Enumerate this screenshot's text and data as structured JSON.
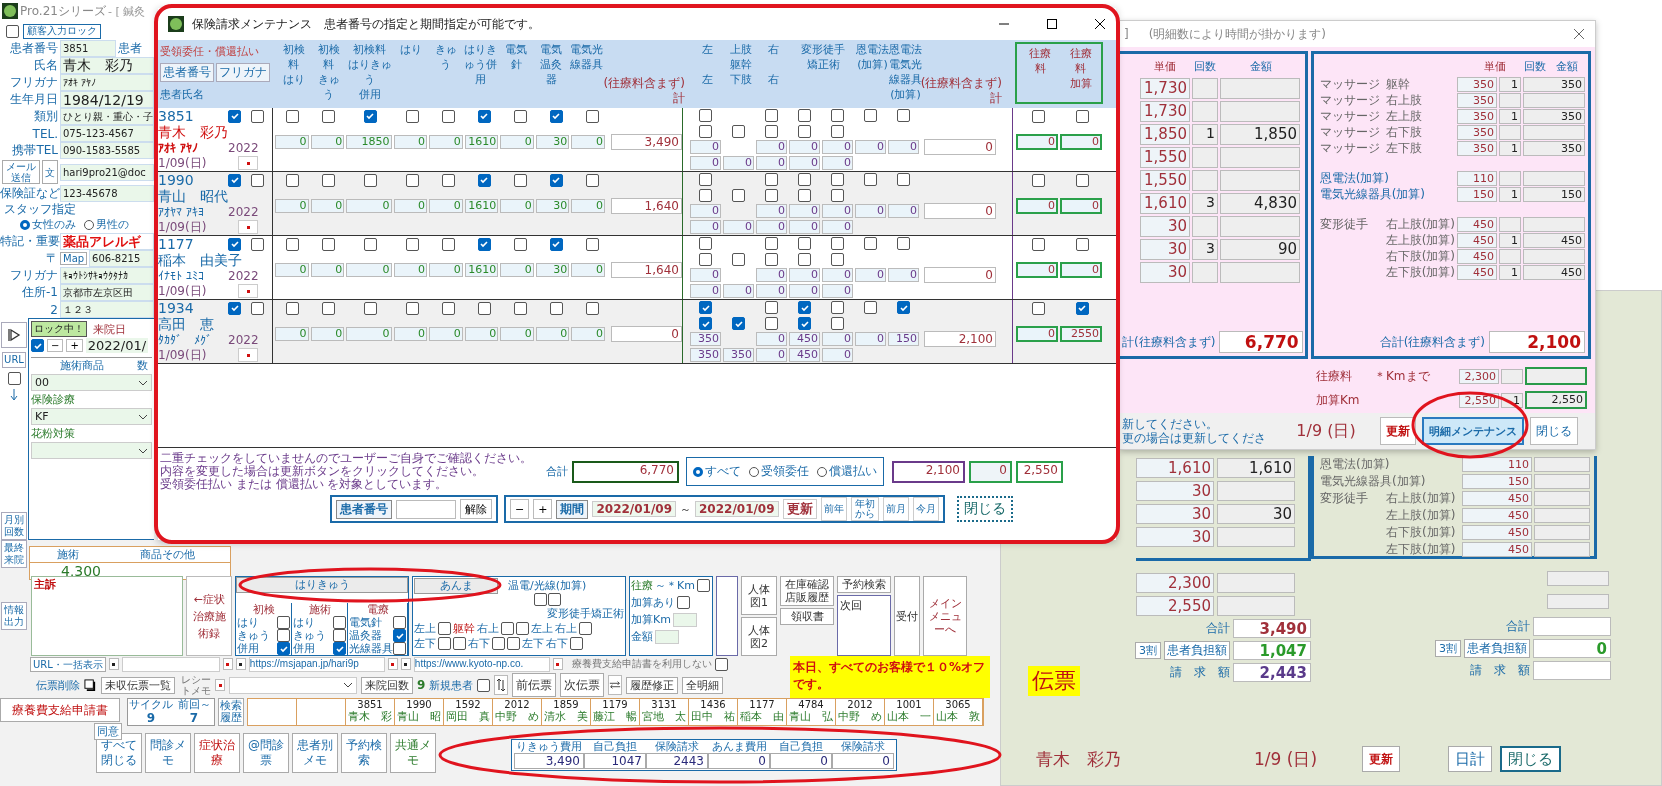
{
  "app": {
    "title": "Pro.21シリーズ",
    "title_suffix": "- [ 鍼灸",
    "lock_button": "顧客入力ロック",
    "lock_checked": false,
    "patient": [
      {
        "kind": "field",
        "label": "患者番号",
        "value": "3851",
        "extra": "患者"
      },
      {
        "kind": "large",
        "label": "氏名",
        "value": "青木　彩乃"
      },
      {
        "kind": "field",
        "label": "フリガナ",
        "value": "ｱｵｷ ｱﾔﾉ"
      },
      {
        "kind": "large",
        "label": "生年月日",
        "value": "1984/12/19"
      },
      {
        "kind": "field",
        "label": "類別",
        "value": "ひとり親・重心・子"
      },
      {
        "kind": "field",
        "label": "TEL.",
        "value": "075-123-4567"
      },
      {
        "kind": "field",
        "label": "携帯TEL",
        "value": "090-1583-5585"
      },
      {
        "kind": "mail",
        "buttons": [
          "メール送信",
          "文"
        ],
        "value": "hari9pro21@doc"
      },
      {
        "kind": "field",
        "label": "保険証など",
        "value": "123-45678"
      },
      {
        "kind": "radio",
        "label": "スタッフ指定",
        "options": [
          {
            "label": "女性のみ",
            "selected": true
          },
          {
            "label": "男性の",
            "selected": false
          }
        ]
      },
      {
        "kind": "alert",
        "label": "特記・重要",
        "value": "薬品アレルギ"
      },
      {
        "kind": "postal",
        "label": "〒",
        "button": "Map",
        "value": "606-8215"
      },
      {
        "kind": "field",
        "label": "フリガナ",
        "value": "ｷｮｳﾄｼｻｷｮｳｸﾀﾅｶ"
      },
      {
        "kind": "field",
        "label": "住所-1",
        "value": "京都市左京区田"
      },
      {
        "kind": "field",
        "label": "2",
        "value": "１２３"
      }
    ],
    "url_button": "URL",
    "strip_checked": false,
    "month_buttons": [
      "月別回数",
      "最終来院"
    ],
    "info_button": "情報出力",
    "visit": {
      "lock": "ロック中！",
      "label": "来院日",
      "checked": true,
      "minus": "−",
      "plus": "+",
      "date": "2022/01/",
      "product_label": "施術商品",
      "qty_label": "数",
      "products": [
        {
          "value": "00"
        },
        {
          "title": "保険診療",
          "value": "KF"
        },
        {
          "title": "花粉対策"
        }
      ]
    },
    "sales": {
      "columns": [
        "施術",
        "商品その他"
      ],
      "value": "4,300"
    },
    "complaint": "主訴",
    "symptom_button": "←症状治療施術録",
    "hk": {
      "button": "はりきゅう",
      "groups": [
        {
          "title": "初検",
          "items": [
            {
              "label": "はり",
              "checked": false
            },
            {
              "label": "きゅう",
              "checked": false
            },
            {
              "label": "併用",
              "checked": true
            }
          ]
        },
        {
          "title": "施術",
          "items": [
            {
              "label": "はり",
              "checked": false
            },
            {
              "label": "きゅう",
              "checked": false
            },
            {
              "label": "併用",
              "checked": true
            }
          ]
        },
        {
          "title": "電療",
          "items": [
            {
              "label": "電気針",
              "checked": false
            },
            {
              "label": "温灸器",
              "checked": true
            },
            {
              "label": "光線器具",
              "checked": false
            }
          ]
        }
      ]
    },
    "anma": {
      "button": "あんま",
      "onden_label": "温電/光線(加算)",
      "onden": [
        {
          "checked": false
        },
        {
          "checked": false
        }
      ],
      "deform_label": "変形徒手矯正術",
      "lines": [
        [
          {
            "kind": "label",
            "text": "左上"
          },
          {
            "kind": "check",
            "checked": false
          },
          {
            "kind": "label",
            "text": "躯幹",
            "accent": true
          },
          {
            "kind": "label",
            "text": "右上"
          },
          {
            "kind": "check",
            "checked": false
          },
          {
            "kind": "check",
            "checked": false
          },
          {
            "kind": "label",
            "text": "左上"
          },
          {
            "kind": "label",
            "text": "右上"
          },
          {
            "kind": "check",
            "checked": false
          }
        ],
        [
          {
            "kind": "label",
            "text": "左下"
          },
          {
            "kind": "check",
            "checked": false
          },
          {
            "kind": "check",
            "checked": false
          },
          {
            "kind": "label",
            "text": "右下"
          },
          {
            "kind": "check",
            "checked": false
          },
          {
            "kind": "check",
            "checked": false
          },
          {
            "kind": "label",
            "text": "左下"
          },
          {
            "kind": "label",
            "text": "右下"
          },
          {
            "kind": "check",
            "checked": false
          }
        ]
      ]
    },
    "ouryo": {
      "title": "往療",
      "range": "～＊Km",
      "checked": false,
      "add_label": "加算あり",
      "add_checked": false,
      "km_label": "加算Km",
      "amount_label": "金額"
    },
    "body_buttons": [
      "人体図1",
      "人体図2"
    ],
    "tools": {
      "stock": "在庫確認店販履歴",
      "receipt": "領収書",
      "reserve": "予約検索",
      "next": "次回",
      "accept": "受付",
      "menu": "メインメニューへ"
    },
    "notice": "本日、すべてのお客様で１０%オフです。",
    "url_row": {
      "button": "URL・一括表示",
      "urls": [
        "https://msjapan.jp/hari9p",
        "https://www.kyoto-np.co."
      ]
    },
    "opt_out": {
      "label": "療養費支給申請書を利用しない",
      "checked": false
    },
    "slip_row": {
      "delete": "伝票削除",
      "unpaid": "未収伝票一覧",
      "receipt_label": "レシートメモ",
      "visits_label": "来院回数",
      "visits": "9",
      "new_label": "新規患者",
      "new_checked": false,
      "prev": "前伝票",
      "next": "次伝票",
      "history": "履歴修正",
      "all": "全明細"
    },
    "claim_row": {
      "button": "療養費支給申請書",
      "agree": "同意",
      "cycle_label": "サイクル",
      "cycle": "9",
      "prev_label": "前回～",
      "prev": "7",
      "search": "検索履歴",
      "recent": [
        {
          "id": "3851",
          "name": "青木　彩"
        },
        {
          "id": "1990",
          "name": "青山　昭"
        },
        {
          "id": "1592",
          "name": "岡田　真"
        },
        {
          "id": "2012",
          "name": "中野　め"
        },
        {
          "id": "1859",
          "name": "清水　美"
        },
        {
          "id": "1179",
          "name": "藤江　暢"
        },
        {
          "id": "3131",
          "name": "宮地　太"
        },
        {
          "id": "1436",
          "name": "田中　祐"
        },
        {
          "id": "1177",
          "name": "稲本　由"
        },
        {
          "id": "4784",
          "name": "青山　弘"
        },
        {
          "id": "2012",
          "name": "中野　め"
        },
        {
          "id": "1001",
          "name": "山本　一"
        },
        {
          "id": "3065",
          "name": "山本　敦"
        }
      ]
    },
    "bottom_buttons": [
      "すべて閉じる",
      "問診メモ",
      "症状治療",
      "@問診票",
      "患者別メモ",
      "予約検索",
      "共通メモ"
    ],
    "summary": {
      "columns": [
        "りきゅう費用",
        "自己負担",
        "保険請求",
        "あんま費用",
        "自己負担",
        "保険請求"
      ],
      "values": [
        "3,490",
        "1047",
        "2443",
        "0",
        "0",
        "0"
      ]
    }
  },
  "dialog": {
    "title": "保険請求メンテナンス　患者番号の指定と期間指定が可能です。",
    "header": {
      "payment": "受領委任・償還払い",
      "sort_buttons": [
        "患者番号",
        "フリガナ"
      ],
      "name_label": "患者氏名",
      "left_columns": [
        [
          "初検",
          "料",
          "はり"
        ],
        [
          "初検",
          "料",
          "きゅ",
          "う"
        ],
        [
          "初検料",
          "はりきゅ",
          "う",
          "併用"
        ],
        [
          "はり"
        ],
        [
          "きゅ",
          "う"
        ],
        [
          "はりき",
          "ゅう併",
          "用"
        ],
        [
          "電気",
          "針"
        ],
        [
          "電気",
          "温灸",
          "器"
        ],
        [
          "電気光",
          "線器具"
        ]
      ],
      "left_total": [
        "(往療料含まず)",
        "計"
      ],
      "right_columns": [
        [
          "左",
          "左"
        ],
        [
          "上肢",
          "躯幹",
          "下肢"
        ],
        [
          "右",
          "右"
        ],
        [
          "変形徒手",
          "矯正術"
        ],
        [
          "恩電法",
          "(加算)"
        ],
        [
          "恩電法",
          "電気光",
          "線器具",
          "(加算)"
        ]
      ],
      "right_total": [
        "(往療料含まず)",
        "計"
      ],
      "outbound_columns": [
        [
          "往療",
          "料"
        ],
        [
          "往療",
          "料",
          "加算"
        ]
      ]
    },
    "rows": [
      {
        "id": "3851",
        "name": "青木　彩乃",
        "kana": "ｱｵｷ ｱﾔﾉ",
        "current": true,
        "year": "2022",
        "date": "1/09(日)",
        "select": true,
        "flag": false,
        "items": [
          {
            "checked": false,
            "value": "0"
          },
          {
            "checked": false,
            "value": "0"
          },
          {
            "checked": true,
            "value": "1850"
          },
          {
            "checked": false,
            "value": "0"
          },
          {
            "checked": false,
            "value": "0"
          },
          {
            "checked": true,
            "value": "1610"
          },
          {
            "checked": false,
            "value": "0"
          },
          {
            "checked": true,
            "value": "30"
          },
          {
            "checked": false,
            "value": "0"
          }
        ],
        "total": "3,490",
        "massage_top": [
          {
            "checked": false,
            "value": "0"
          },
          {
            "checked": false,
            "value": "0"
          },
          {
            "checked": false,
            "value": "0"
          },
          {
            "checked": false,
            "value": "0"
          },
          {
            "checked": false,
            "value": "0"
          },
          {
            "checked": false,
            "value": "0"
          }
        ],
        "massage_bottom": [
          {
            "checked": false,
            "value": "0"
          },
          {
            "checked": false,
            "value": "0"
          },
          {
            "checked": false,
            "value": "0"
          },
          {
            "checked": false,
            "value": "0"
          },
          {
            "checked": false,
            "value": "0"
          }
        ],
        "massage_total": "0",
        "outbound": [
          {
            "checked": false,
            "value": "0"
          },
          {
            "checked": false,
            "value": "0"
          }
        ]
      },
      {
        "id": "1990",
        "name": "青山　昭代",
        "kana": "ｱｵﾔﾏ ｱｷﾖ",
        "current": false,
        "year": "2022",
        "date": "1/09(日)",
        "select": true,
        "flag": false,
        "items": [
          {
            "checked": false,
            "value": "0"
          },
          {
            "checked": false,
            "value": "0"
          },
          {
            "checked": false,
            "value": "0"
          },
          {
            "checked": false,
            "value": "0"
          },
          {
            "checked": false,
            "value": "0"
          },
          {
            "checked": true,
            "value": "1610"
          },
          {
            "checked": false,
            "value": "0"
          },
          {
            "checked": true,
            "value": "30"
          },
          {
            "checked": false,
            "value": "0"
          }
        ],
        "total": "1,640",
        "massage_top": [
          {
            "checked": false,
            "value": "0"
          },
          {
            "checked": false,
            "value": "0"
          },
          {
            "checked": false,
            "value": "0"
          },
          {
            "checked": false,
            "value": "0"
          },
          {
            "checked": false,
            "value": "0"
          },
          {
            "checked": false,
            "value": "0"
          }
        ],
        "massage_bottom": [
          {
            "checked": false,
            "value": "0"
          },
          {
            "checked": false,
            "value": "0"
          },
          {
            "checked": false,
            "value": "0"
          },
          {
            "checked": false,
            "value": "0"
          },
          {
            "checked": false,
            "value": "0"
          }
        ],
        "massage_total": "0",
        "outbound": [
          {
            "checked": false,
            "value": "0"
          },
          {
            "checked": false,
            "value": "0"
          }
        ]
      },
      {
        "id": "1177",
        "name": "稲本　由美子",
        "kana": "ｲﾅﾓﾄ ﾕﾐｺ",
        "current": false,
        "year": "2022",
        "date": "1/09(日)",
        "select": true,
        "flag": false,
        "items": [
          {
            "checked": false,
            "value": "0"
          },
          {
            "checked": false,
            "value": "0"
          },
          {
            "checked": false,
            "value": "0"
          },
          {
            "checked": false,
            "value": "0"
          },
          {
            "checked": false,
            "value": "0"
          },
          {
            "checked": true,
            "value": "1610"
          },
          {
            "checked": false,
            "value": "0"
          },
          {
            "checked": true,
            "value": "30"
          },
          {
            "checked": false,
            "value": "0"
          }
        ],
        "total": "1,640",
        "massage_top": [
          {
            "checked": false,
            "value": "0"
          },
          {
            "checked": false,
            "value": "0"
          },
          {
            "checked": false,
            "value": "0"
          },
          {
            "checked": false,
            "value": "0"
          },
          {
            "checked": false,
            "value": "0"
          },
          {
            "checked": false,
            "value": "0"
          }
        ],
        "massage_bottom": [
          {
            "checked": false,
            "value": "0"
          },
          {
            "checked": false,
            "value": "0"
          },
          {
            "checked": false,
            "value": "0"
          },
          {
            "checked": false,
            "value": "0"
          },
          {
            "checked": false,
            "value": "0"
          }
        ],
        "massage_total": "0",
        "outbound": [
          {
            "checked": false,
            "value": "0"
          },
          {
            "checked": false,
            "value": "0"
          }
        ]
      },
      {
        "id": "1934",
        "name": "高田　恵",
        "kana": "ﾀｶﾀﾞ　ﾒｸﾞ",
        "current": false,
        "year": "2022",
        "date": "1/09(日)",
        "select": true,
        "flag": false,
        "items": [
          {
            "checked": false,
            "value": "0"
          },
          {
            "checked": false,
            "value": "0"
          },
          {
            "checked": false,
            "value": "0"
          },
          {
            "checked": false,
            "value": "0"
          },
          {
            "checked": false,
            "value": "0"
          },
          {
            "checked": false,
            "value": "0"
          },
          {
            "checked": false,
            "value": "0"
          },
          {
            "checked": false,
            "value": "0"
          },
          {
            "checked": false,
            "value": "0"
          }
        ],
        "total": "0",
        "massage_top": [
          {
            "checked": true,
            "value": "350"
          },
          {
            "checked": false,
            "value": "0"
          },
          {
            "checked": true,
            "value": "450"
          },
          {
            "checked": false,
            "value": "0"
          },
          {
            "checked": false,
            "value": "0"
          },
          {
            "checked": true,
            "value": "150"
          }
        ],
        "massage_bottom": [
          {
            "checked": true,
            "value": "350"
          },
          {
            "checked": true,
            "value": "350"
          },
          {
            "checked": false,
            "value": "0"
          },
          {
            "checked": true,
            "value": "450"
          },
          {
            "checked": false,
            "value": "0"
          }
        ],
        "massage_total": "2,100",
        "outbound": [
          {
            "checked": false,
            "value": "0"
          },
          {
            "checked": true,
            "value": "2550"
          }
        ]
      }
    ],
    "footer": {
      "notes": [
        "二重チェックをしていませんのでユーザーご自身でご確認ください。",
        "内容を変更した場合は更新ボタンをクリックしてください。",
        "受領委任払い または 償還払い を対象としています。"
      ],
      "total_label": "合計",
      "total": "6,770",
      "filters": [
        {
          "label": "すべて",
          "selected": true
        },
        {
          "label": "受領委任",
          "selected": false
        },
        {
          "label": "償還払い",
          "selected": false
        }
      ],
      "totals": [
        "2,100",
        "0",
        "2,550"
      ],
      "patient_label": "患者番号",
      "clear": "解除",
      "minus": "−",
      "plus": "+",
      "period_label": "期間",
      "from": "2022/01/09",
      "tilde": "～",
      "to": "2022/01/09",
      "refresh": "更新",
      "nav": [
        "前年",
        "年初から",
        "前月",
        "今月"
      ],
      "close": "閉じる"
    }
  },
  "detail": {
    "title_prefix": "]",
    "title": "(明細数により時間が掛かります)",
    "left": {
      "columns": [
        "単価",
        "回数",
        "金額"
      ],
      "rows": [
        {
          "price": "1,730"
        },
        {
          "price": "1,730"
        },
        {
          "price": "1,850",
          "count": "1",
          "amount": "1,850"
        },
        {
          "price": "1,550"
        },
        {
          "price": "1,550"
        },
        {
          "price": "1,610",
          "count": "3",
          "amount": "4,830"
        },
        {
          "price": "30"
        },
        {
          "price": "30",
          "count": "3",
          "amount": "90"
        },
        {
          "price": "30"
        }
      ],
      "total_label": "計(往療料含まず)",
      "total": "6,770"
    },
    "right": {
      "columns": [
        "単価",
        "回数",
        "金額"
      ],
      "groups": [
        [
          {
            "label": "マッサージ",
            "part": "躯幹",
            "price": "350",
            "count": "1",
            "amount": "350"
          },
          {
            "label": "マッサージ",
            "part": "右上肢",
            "price": "350"
          },
          {
            "label": "マッサージ",
            "part": "左上肢",
            "price": "350",
            "count": "1",
            "amount": "350"
          },
          {
            "label": "マッサージ",
            "part": "右下肢",
            "price": "350"
          },
          {
            "label": "マッサージ",
            "part": "左下肢",
            "price": "350",
            "count": "1",
            "amount": "350"
          }
        ],
        [
          {
            "label": "恩電法(加算)",
            "price": "110"
          },
          {
            "label": "電気光線器具(加算)",
            "price": "150",
            "count": "1",
            "amount": "150"
          }
        ],
        [
          {
            "label": "変形徒手",
            "part": "右上肢(加算)",
            "price": "450"
          },
          {
            "part": "左上肢(加算)",
            "price": "450",
            "count": "1",
            "amount": "450"
          },
          {
            "part": "右下肢(加算)",
            "price": "450"
          },
          {
            "part": "左下肢(加算)",
            "price": "450",
            "count": "1",
            "amount": "450"
          }
        ]
      ],
      "total_label": "合計(往療料含まず)",
      "total": "2,100"
    },
    "travel": [
      {
        "label": "往療料",
        "note": "＊Kmまで",
        "price": "2,300"
      },
      {
        "label": "加算Km",
        "price": "2,550",
        "count": "1",
        "amount": "2,550"
      }
    ],
    "status": [
      "新してください。",
      "更の場合は更新してくださ"
    ],
    "date": "1/9 (日)",
    "buttons": [
      {
        "label": "更新",
        "selected": false
      },
      {
        "label": "明細メンテナンス",
        "selected": true
      },
      {
        "label": "閉じる",
        "selected": false
      }
    ]
  },
  "slip": {
    "title": "伝票",
    "left_rows": [
      {
        "price": "1,610",
        "amount": "1,610"
      },
      {
        "price": "30"
      },
      {
        "price": "30",
        "amount": "30"
      },
      {
        "price": "30"
      }
    ],
    "right_rows": [
      {
        "label": "恩電法(加算)",
        "price": "110"
      },
      {
        "label": "電気光線器具(加算)",
        "price": "150"
      },
      {
        "label": "変形徒手",
        "part": "右上肢(加算)",
        "price": "450"
      },
      {
        "part": "左上肢(加算)",
        "price": "450"
      },
      {
        "part": "右下肢(加算)",
        "price": "450"
      },
      {
        "part": "左下肢(加算)",
        "price": "450"
      }
    ],
    "travel": [
      "2,300",
      "2,550"
    ],
    "left_summary": [
      {
        "label": "合計",
        "value": "3,490"
      },
      {
        "rate": "3割",
        "label": "患者負担額",
        "value": "1,047"
      },
      {
        "label": "請　求　額",
        "value": "2,443"
      }
    ],
    "right_summary": [
      {
        "label": "合計"
      },
      {
        "rate": "3割",
        "label": "患者負担額",
        "value": "0"
      },
      {
        "label": "請　求　額"
      }
    ],
    "footer": {
      "name": "青木　彩乃",
      "date": "1/9 (日)",
      "buttons": [
        "更新",
        "日計",
        "閉じる"
      ]
    }
  }
}
